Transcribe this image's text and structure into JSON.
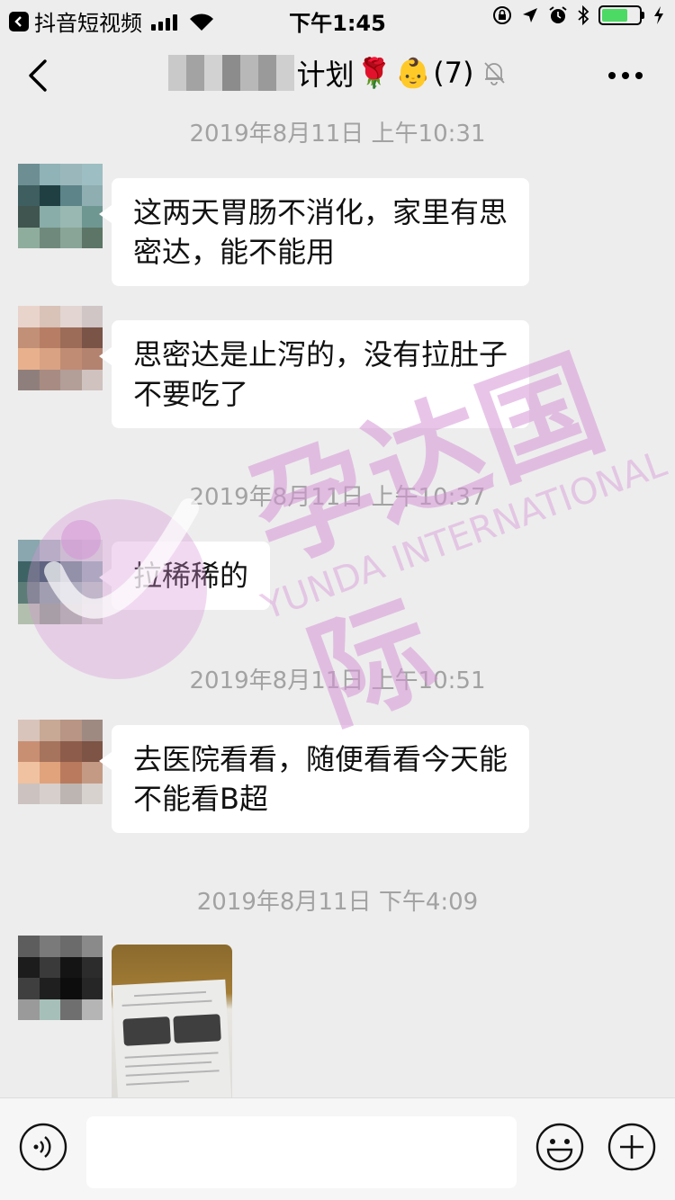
{
  "status_bar": {
    "back_app_label": "抖音短视频",
    "time": "下午1:45",
    "battery_level": 0.7
  },
  "nav": {
    "title_suffix": "计划",
    "title_emoji_1": "🌹",
    "title_emoji_2": "👶",
    "member_count": "(7)",
    "mosaic_colors": [
      "#c9c9c9",
      "#a3a3a3",
      "#d2d2d2",
      "#8c8c8c",
      "#b8b8b8",
      "#9a9a9a",
      "#cfcfcf"
    ]
  },
  "messages": [
    {
      "type": "timestamp",
      "text": "2019年8月11日 上午10:31"
    },
    {
      "type": "text",
      "lines": [
        "这两天胃肠不消化，家里有思",
        "密达，能不能用"
      ],
      "avatar_colors": [
        "#6d8f94",
        "#8fb3b6",
        "#9ab8bb",
        "#9dbec2",
        "#3e5e5f",
        "#1f3f43",
        "#5d8489",
        "#8eaeb1",
        "#40554f",
        "#89ada9",
        "#99b8b2",
        "#6f9792",
        "#8fad9d",
        "#6f8a7c",
        "#88a597",
        "#5c7566"
      ]
    },
    {
      "type": "text",
      "lines": [
        "思密达是止泻的，没有拉肚子",
        "不要吃了"
      ],
      "avatar_colors": [
        "#e9d4cc",
        "#d9c2b8",
        "#e2d5d2",
        "#cfc6c5",
        "#c29077",
        "#b77e65",
        "#9d6c58",
        "#7a5447",
        "#e8b08c",
        "#d8a283",
        "#c18c74",
        "#b38370",
        "#8f7f7c",
        "#a88b82",
        "#b39e98",
        "#cfc2bf"
      ]
    },
    {
      "type": "timestamp",
      "text": "2019年8月11日 上午10:37"
    },
    {
      "type": "text",
      "lines": [
        "拉稀稀的"
      ],
      "avatar_colors": [
        "#8aa6ae",
        "#a8b9be",
        "#c8cfd1",
        "#d6d9da",
        "#3d6365",
        "#1f4a52",
        "#6f8e93",
        "#9ab1b5",
        "#5c7d77",
        "#84a49d",
        "#9fbcb6",
        "#b6c8c4",
        "#b3bfae",
        "#8fa48f",
        "#aab5a7",
        "#c9cdc6"
      ]
    },
    {
      "type": "timestamp",
      "text": "2019年8月11日 上午10:51"
    },
    {
      "type": "text",
      "lines": [
        "去医院看看，随便看看今天能",
        "不能看B超"
      ],
      "avatar_colors": [
        "#d8c4bb",
        "#c7a995",
        "#b89584",
        "#9f8a82",
        "#c98f73",
        "#a6735d",
        "#8d5c4a",
        "#7d5445",
        "#f0c2a1",
        "#e0a37c",
        "#b97a5e",
        "#c59a85",
        "#ccc3c0",
        "#d6cfcc",
        "#bdb5b2",
        "#d8d2cf"
      ]
    },
    {
      "type": "timestamp",
      "text": "2019年8月11日 下午4:09"
    },
    {
      "type": "image",
      "alt": "hospital-ultrasound-report-photo",
      "avatar_colors": [
        "#5d5d5d",
        "#7a7a7a",
        "#6b6b6b",
        "#8a8a8a",
        "#1c1c1c",
        "#3a3a3a",
        "#141414",
        "#2c2c2c",
        "#3f3f3f",
        "#1f1f1f",
        "#0d0d0d",
        "#262626",
        "#9a9a9a",
        "#a6c0b9",
        "#6f6f6f",
        "#b5b5b5"
      ]
    }
  ],
  "watermark": {
    "cn": "孕达国际",
    "en": "YUNDA INTERNATIONAL"
  },
  "input": {
    "placeholder": "",
    "value": ""
  }
}
